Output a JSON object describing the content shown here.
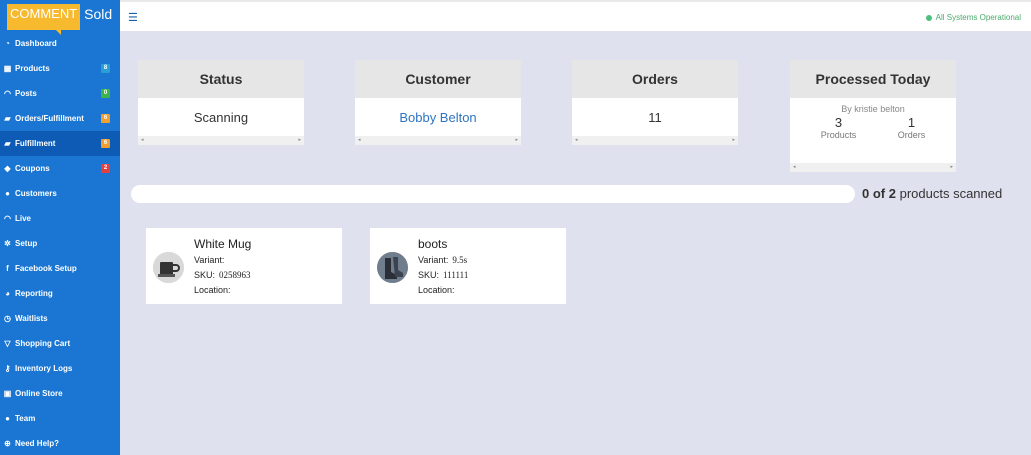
{
  "logo": {
    "part1": "COMMENT",
    "part2": "Sold"
  },
  "colors": {
    "sidebar": "#1a76d2",
    "accent": "#f7b92d",
    "status_green": "#4ac07a",
    "link": "#2f74c0"
  },
  "nav": [
    {
      "label": "Dashboard",
      "icon": "dashboard-icon"
    },
    {
      "label": "Products",
      "icon": "grid-icon",
      "badge": "8",
      "badge_color": "#2a9fd6"
    },
    {
      "label": "Posts",
      "icon": "rss-icon",
      "badge": "0",
      "badge_color": "#3cb44b"
    },
    {
      "label": "Orders/Fulfillment",
      "icon": "truck-icon",
      "badge": "6",
      "badge_color": "#f0a030"
    },
    {
      "label": "Fulfillment",
      "icon": "truck-icon",
      "badge": "6",
      "badge_color": "#f0a030"
    },
    {
      "label": "Coupons",
      "icon": "tag-icon",
      "badge": "2",
      "badge_color": "#e04040"
    },
    {
      "label": "Customers",
      "icon": "user-icon"
    },
    {
      "label": "Live",
      "icon": "rss-icon"
    },
    {
      "label": "Setup",
      "icon": "cogs-icon"
    },
    {
      "label": "Facebook Setup",
      "icon": "facebook-icon"
    },
    {
      "label": "Reporting",
      "icon": "pie-icon"
    },
    {
      "label": "Waitlists",
      "icon": "clock-icon"
    },
    {
      "label": "Shopping Cart",
      "icon": "cart-icon"
    },
    {
      "label": "Inventory Logs",
      "icon": "key-icon"
    },
    {
      "label": "Online Store",
      "icon": "store-icon"
    },
    {
      "label": "Team",
      "icon": "user-icon"
    },
    {
      "label": "Need Help?",
      "icon": "help-icon"
    }
  ],
  "topbar": {
    "status": "All Systems Operational"
  },
  "cards": {
    "status": {
      "title": "Status",
      "value": "Scanning"
    },
    "customer": {
      "title": "Customer",
      "value": "Bobby Belton"
    },
    "orders": {
      "title": "Orders",
      "value": "11"
    },
    "processed": {
      "title": "Processed Today",
      "by": "By kristie belton",
      "products_count": "3",
      "products_label": "Products",
      "orders_count": "1",
      "orders_label": "Orders"
    }
  },
  "progress": {
    "scanned": "0 of 2",
    "suffix": "products scanned",
    "fraction": 0
  },
  "products": [
    {
      "name": "White Mug",
      "variant_label": "Variant:",
      "variant": "",
      "sku_label": "SKU:",
      "sku": "0258963",
      "location_label": "Location:",
      "location": ""
    },
    {
      "name": "boots",
      "variant_label": "Variant:",
      "variant": "9.5s",
      "sku_label": "SKU:",
      "sku": "111111",
      "location_label": "Location:",
      "location": ""
    }
  ]
}
